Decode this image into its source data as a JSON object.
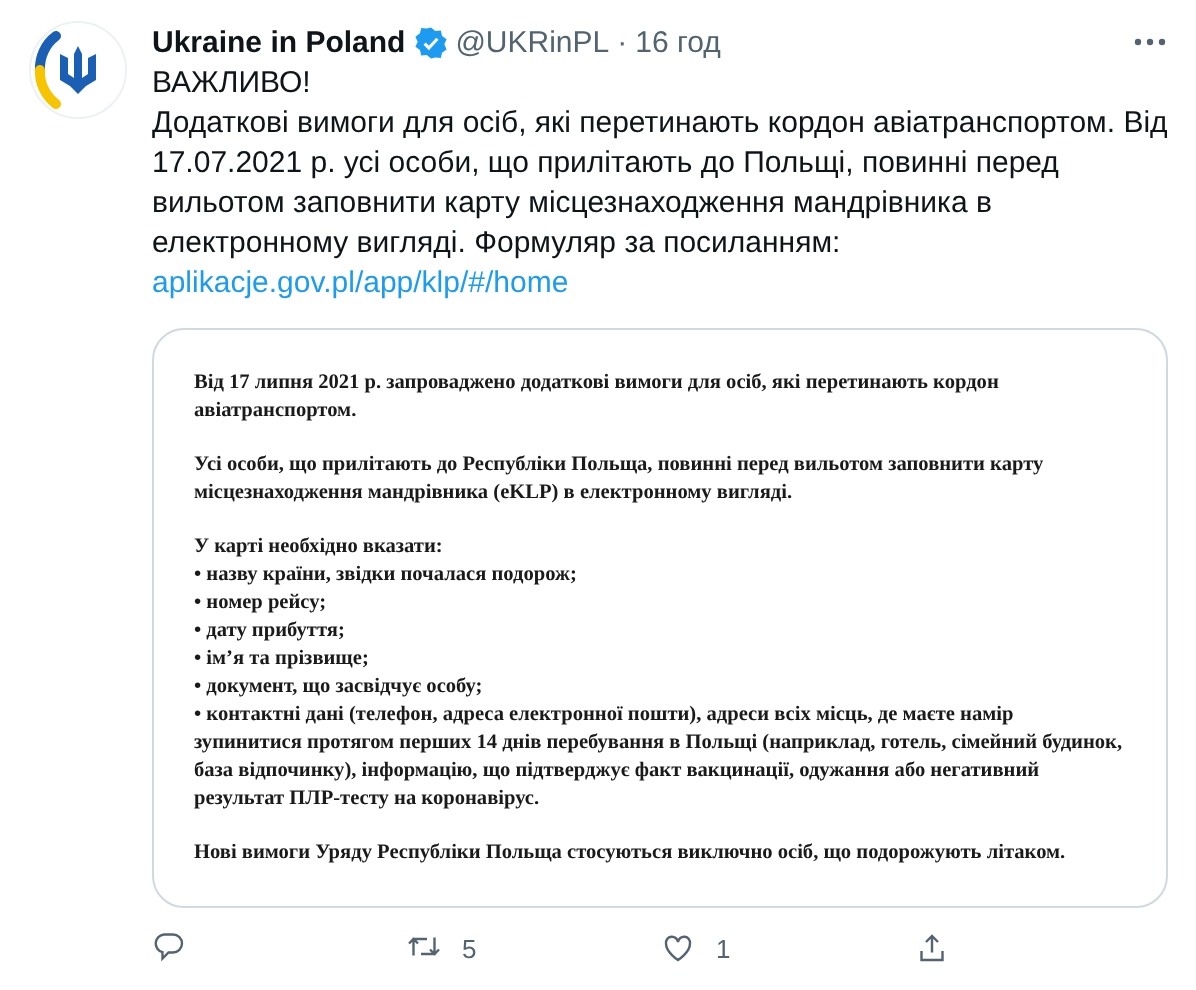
{
  "author": {
    "name": "Ukraine in Poland",
    "verified": true,
    "handle": "@UKRinPL",
    "separator": "·",
    "time": "16 год"
  },
  "tweet": {
    "heading": "ВАЖЛИВО!",
    "text": "Додаткові вимоги для осіб, які перетинають кордон авіатранспортом. Від 17.07.2021 р. усі особи, що прилітають до Польщі, повинні перед вильотом заповнити карту місцезнаходження мандрівника в електронному вигляді. Формуляр за посиланням:",
    "link": "aplikacje.gov.pl/app/klp/#/home"
  },
  "document": {
    "paragraphs": [
      {
        "lines": [
          "Від 17 липня 2021 р. запроваджено додаткові вимоги для осіб, які перетинають кордон авіатранспортом."
        ]
      },
      {
        "lines": [
          "Усі особи, що прилітають до Республіки Польща, повинні перед вильотом заповнити карту місцезнаходження мандрівника (eKLP) в електронному вигляді."
        ]
      },
      {
        "lines": [
          "У карті необхідно вказати:",
          "• назву країни, звідки почалася подорож;",
          "• номер рейсу;",
          "• дату прибуття;",
          "• ім’я та прізвище;",
          "• документ, що засвідчує особу;",
          "• контактні дані (телефон, адреса електронної пошти), адреси всіх місць, де маєте намір зупинитися протягом перших 14 днів перебування в Польщі (наприклад, готель, сімейний будинок, база відпочинку), інформацію, що підтверджує факт вакцинації, одужання або негативний результат ПЛР-тесту на коронавірус."
        ]
      },
      {
        "lines": [
          "Нові вимоги Уряду Республіки Польща стосуються виключно осіб, що подорожують літаком."
        ]
      }
    ]
  },
  "actions": [
    {
      "kind": "reply"
    },
    {
      "kind": "retweet",
      "count": "5"
    },
    {
      "kind": "like",
      "count": "1"
    },
    {
      "kind": "share"
    }
  ]
}
